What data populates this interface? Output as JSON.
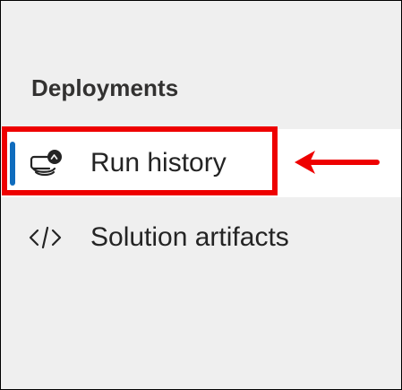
{
  "sidebar": {
    "section_title": "Deployments",
    "items": [
      {
        "label": "Run history",
        "icon": "run-history-icon",
        "selected": true
      },
      {
        "label": "Solution artifacts",
        "icon": "code-icon",
        "selected": false
      }
    ]
  },
  "annotation": {
    "highlight_color": "#ee0000",
    "arrow": "left-arrow-icon"
  },
  "colors": {
    "selection_indicator": "#0f6cbd",
    "panel_background": "#efefef",
    "selected_background": "#ffffff"
  }
}
